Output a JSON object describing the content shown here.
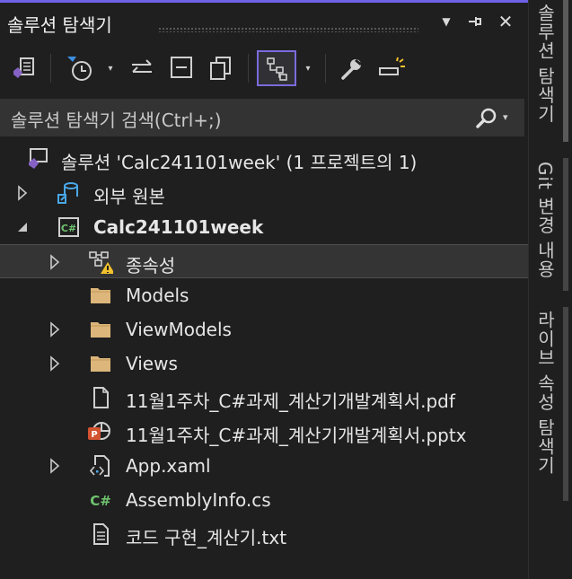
{
  "header": {
    "title": "솔루션 탐색기"
  },
  "window_buttons": {
    "dropdown": "▼",
    "pin": "⊣",
    "close": "✕"
  },
  "search": {
    "placeholder": "솔루션 탐색기 검색(Ctrl+;)"
  },
  "toolbar": {
    "dropdown_glyph": "▾"
  },
  "tree": {
    "solution": "솔루션 'Calc241101week'  (1 프로젝트의 1)",
    "external_sources": "외부 원본",
    "project": "Calc241101week",
    "dependencies": "종속성",
    "models": "Models",
    "viewmodels": "ViewModels",
    "views": "Views",
    "pdf": "11월1주차_C#과제_계산기개발계획서.pdf",
    "pptx": "11월1주차_C#과제_계산기개발계획서.pptx",
    "app_xaml": "App.xaml",
    "assemblyinfo": "AssemblyInfo.cs",
    "txt": "코드 구현_계산기.txt"
  },
  "side_tabs": [
    {
      "label": "솔루션 탐색기"
    },
    {
      "label": "Git 변경 내용"
    },
    {
      "label": "라이브 속성 탐색기"
    }
  ],
  "colors": {
    "accent": "#7160e8",
    "folder": "#dcb67a",
    "csharp": "#6fc36f",
    "link": "#4aa8e8",
    "warning": "#f2c12e",
    "powerpoint": "#d35230"
  }
}
